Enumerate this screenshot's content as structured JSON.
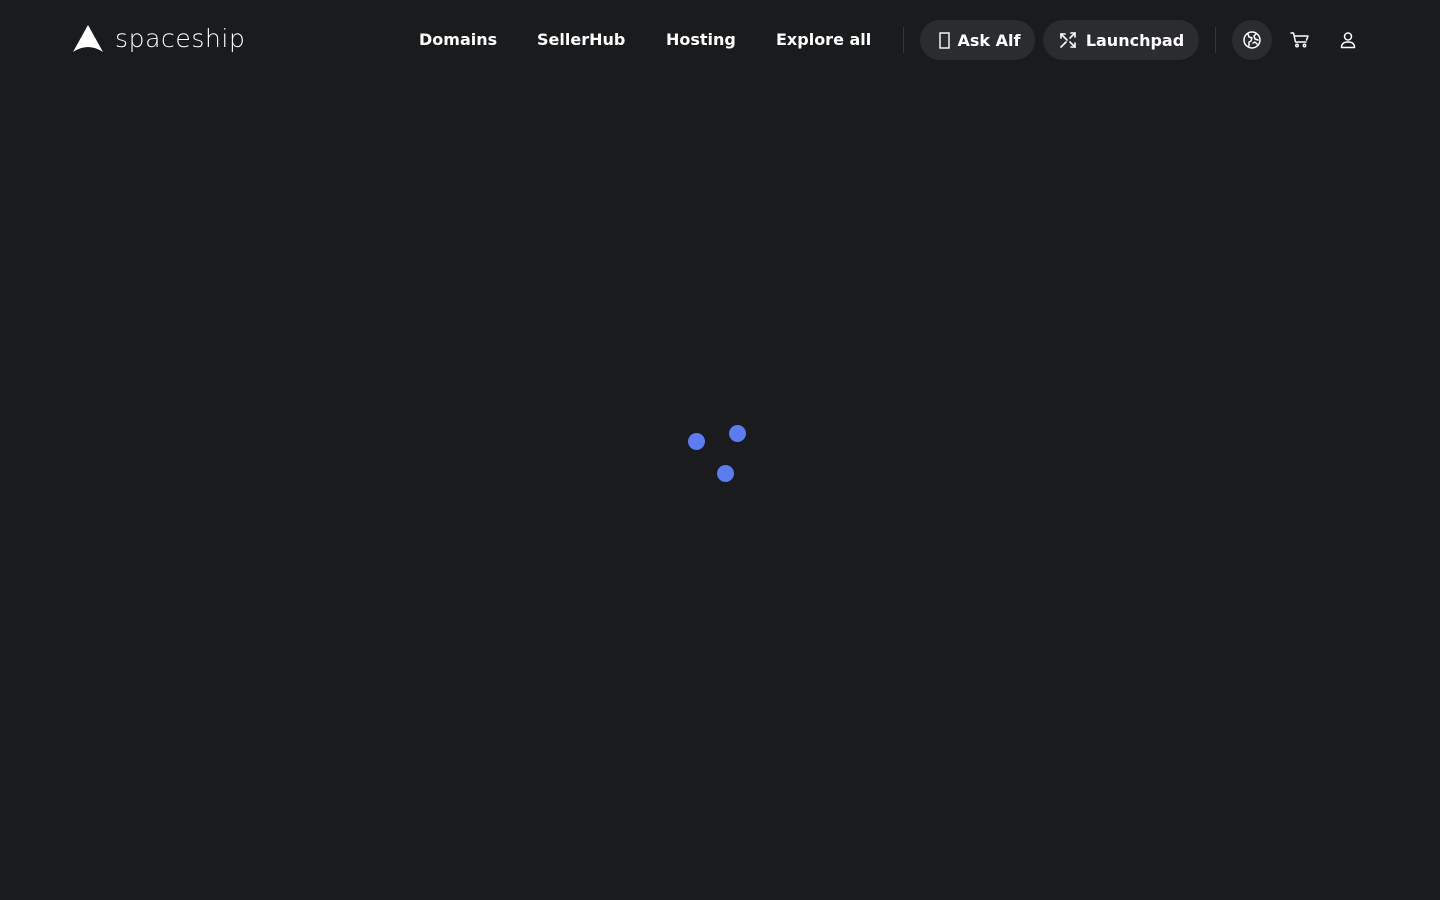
{
  "header": {
    "logo": {
      "text": "spaceship"
    },
    "nav": [
      {
        "label": "Domains"
      },
      {
        "label": "SellerHub"
      },
      {
        "label": "Hosting"
      },
      {
        "label": "Explore all"
      }
    ],
    "ask_alf": {
      "label": "Ask Alf",
      "icon": "glyph-placeholder-icon"
    },
    "launchpad": {
      "label": "Launchpad",
      "icon": "launchpad-icon"
    },
    "icons": {
      "language": "globe-icon",
      "cart": "cart-icon",
      "account": "user-icon"
    }
  },
  "loader": {
    "icon": "loading-spinner-icon"
  },
  "colors": {
    "background": "#1a1b1d",
    "pill_background": "#2a2c30",
    "accent": "#5b7cf2",
    "text": "#ffffff"
  }
}
